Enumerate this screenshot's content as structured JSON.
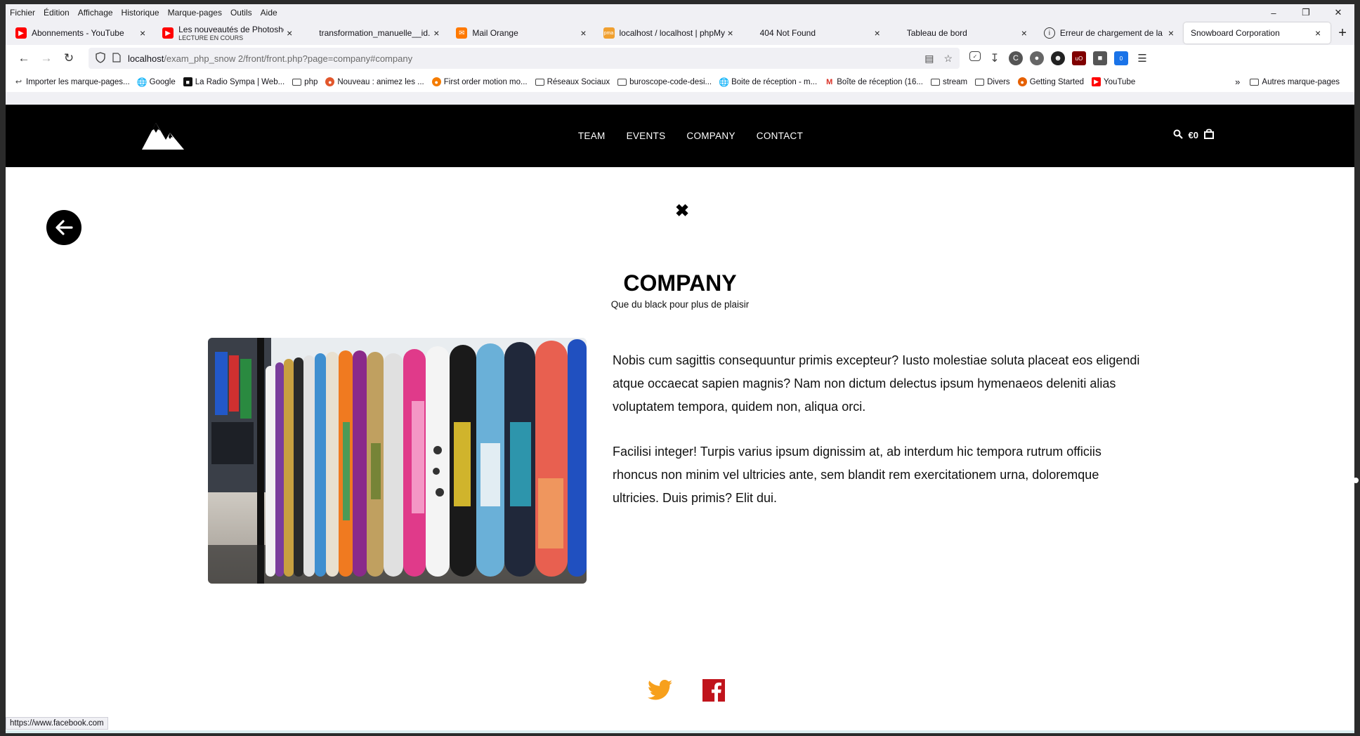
{
  "menubar": {
    "items": [
      "Fichier",
      "Édition",
      "Affichage",
      "Historique",
      "Marque-pages",
      "Outils",
      "Aide"
    ]
  },
  "tabs": [
    {
      "label": "Abonnements - YouTube",
      "icon": "youtube-icon",
      "color": "#ff0000"
    },
    {
      "label": "Les nouveautés de Photosho",
      "sub": "LECTURE EN COURS",
      "icon": "youtube-icon",
      "color": "#ff0000"
    },
    {
      "label": "transformation_manuelle__id.pn",
      "icon": "none",
      "color": "#ffffff"
    },
    {
      "label": "Mail Orange",
      "icon": "mail-icon",
      "color": "#ff7900"
    },
    {
      "label": "localhost / localhost | phpMy",
      "icon": "phpmyadmin-icon",
      "color": "#f0a030"
    },
    {
      "label": "404 Not Found",
      "icon": "none",
      "color": "#ffffff"
    },
    {
      "label": "Tableau de bord",
      "icon": "none",
      "color": "#ffffff"
    },
    {
      "label": "Erreur de chargement de la p",
      "icon": "info-icon",
      "color": "#333333"
    },
    {
      "label": "Snowboard Corporation",
      "icon": "none",
      "color": "#ffffff",
      "active": true
    }
  ],
  "urlbar": {
    "host": "localhost",
    "path": "/exam_php_snow 2/front/front.php?page=company#company"
  },
  "bookmarks": [
    {
      "label": "Importer les marque-pages...",
      "type": "import",
      "color": "#555555"
    },
    {
      "label": "Google",
      "type": "globe",
      "color": "#555555"
    },
    {
      "label": "La Radio Sympa | Web...",
      "type": "site",
      "color": "#111111"
    },
    {
      "label": "php",
      "type": "folder",
      "color": "#444444"
    },
    {
      "label": "Nouveau : animez les ...",
      "type": "site",
      "color": "#e2572c"
    },
    {
      "label": "First order motion mo...",
      "type": "site",
      "color": "#f57c00"
    },
    {
      "label": "Réseaux Sociaux",
      "type": "folder",
      "color": "#444444"
    },
    {
      "label": "buroscope-code-desi...",
      "type": "folder",
      "color": "#444444"
    },
    {
      "label": "Boite de réception - m...",
      "type": "globe",
      "color": "#555555"
    },
    {
      "label": "Boîte de réception (16...",
      "type": "gmail",
      "color": "#d93025"
    },
    {
      "label": "stream",
      "type": "folder",
      "color": "#444444"
    },
    {
      "label": "Divers",
      "type": "folder",
      "color": "#444444"
    },
    {
      "label": "Getting Started",
      "type": "firefox",
      "color": "#e66000"
    },
    {
      "label": "YouTube",
      "type": "youtube",
      "color": "#ff0000"
    }
  ],
  "bookmarks_other": "Autres marque-pages",
  "site": {
    "nav": [
      "TEAM",
      "EVENTS",
      "COMPANY",
      "CONTACT"
    ],
    "cart_total": "€0",
    "title": "COMPANY",
    "subtitle": "Que du black pour plus de plaisir",
    "paragraphs": [
      "Nobis cum sagittis consequuntur primis excepteur? Iusto molestiae soluta placeat eos eligendi atque occaecat sapien magnis? Nam non dictum delectus ipsum hymenaeos deleniti alias voluptatem tempora, quidem non, aliqua orci.",
      "Facilisi integer! Turpis varius ipsum dignissim at, ab interdum hic tempora rutrum officiis rhoncus non minim vel ultricies ante, sem blandit rem exercitationem urna, doloremque ultricies. Duis primis? Elit dui."
    ],
    "image_alt": "snowboards-rack-image",
    "social": [
      {
        "name": "twitter-icon",
        "color": "#f7a01c"
      },
      {
        "name": "facebook-icon",
        "color": "#c0141c"
      }
    ]
  },
  "status_url": "https://www.facebook.com"
}
